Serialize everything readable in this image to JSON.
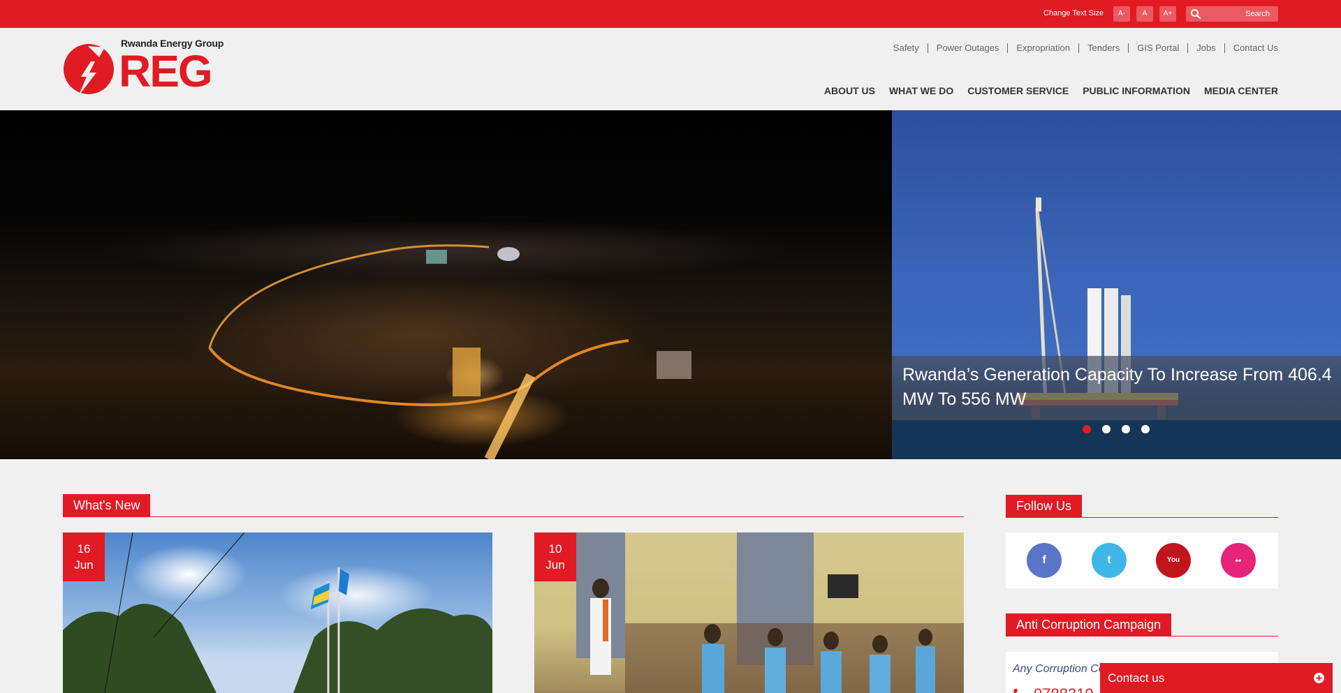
{
  "topbar": {
    "text_size_label": "Change Text Size",
    "text_size_buttons": [
      "A-",
      "A",
      "A+"
    ],
    "search_placeholder": "Search"
  },
  "logo": {
    "tagline": "Rwanda Energy Group",
    "wordmark": "REG"
  },
  "utility_nav": [
    "Safety",
    "Power Outages",
    "Expropriation",
    "Tenders",
    "GIS Portal",
    "Jobs",
    "Contact Us"
  ],
  "main_nav": [
    "ABOUT US",
    "WHAT WE DO",
    "CUSTOMER SERVICE",
    "PUBLIC INFORMATION",
    "MEDIA CENTER"
  ],
  "slider": {
    "caption": "Rwanda’s Generation Capacity To Increase From 406.4 MW To 556 MW",
    "slide_count": 4,
    "active_index": 0
  },
  "whats_new": {
    "title": "What's New",
    "items": [
      {
        "day": "16",
        "month": "Jun"
      },
      {
        "day": "10",
        "month": "Jun"
      }
    ]
  },
  "follow_us": {
    "title": "Follow Us",
    "networks": [
      {
        "name": "facebook",
        "glyph": "f",
        "color": "#5a74c8"
      },
      {
        "name": "twitter",
        "glyph": "t",
        "color": "#3fb6e8"
      },
      {
        "name": "youtube",
        "glyph": "You",
        "color": "#c0151c"
      },
      {
        "name": "flickr",
        "glyph": "••",
        "color": "#e6247a"
      }
    ]
  },
  "anti_corruption": {
    "title": "Anti Corruption Campaign",
    "text": "Any Corruption Co",
    "phone": "0788310"
  },
  "contact_tab": {
    "label": "Contact us"
  },
  "colors": {
    "brand_red": "#e01b24",
    "page_bg": "#f0f0f0"
  }
}
